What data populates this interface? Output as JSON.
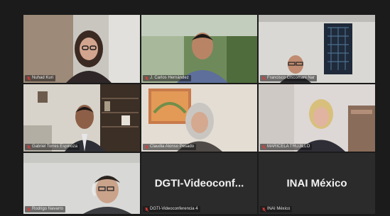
{
  "tiles": [
    {
      "name": "Nuhad Kuri"
    },
    {
      "name": "J. Carlos Hernández"
    },
    {
      "name": "Francisco Ciscomani Nar"
    },
    {
      "name": "Gabriel Torres Espinoza"
    },
    {
      "name": "Claudia Alonso Pesado"
    },
    {
      "name": "MARICELA TRUJILLO"
    },
    {
      "name": "Rodrigo Navarro"
    },
    {
      "name": "DGTI-Videoconferencia 4",
      "display": "DGTI-Videoconf..."
    },
    {
      "name": "INAI México",
      "display": "INAI México"
    }
  ],
  "colors": {
    "background": "#1b1b1b",
    "tile_empty": "#2b2b2b",
    "active_speaker_border": "#b5d46a",
    "muted_mic": "#e03a3a"
  },
  "icons": {
    "muted": "mic-muted-icon"
  },
  "active_speaker_index": 5
}
